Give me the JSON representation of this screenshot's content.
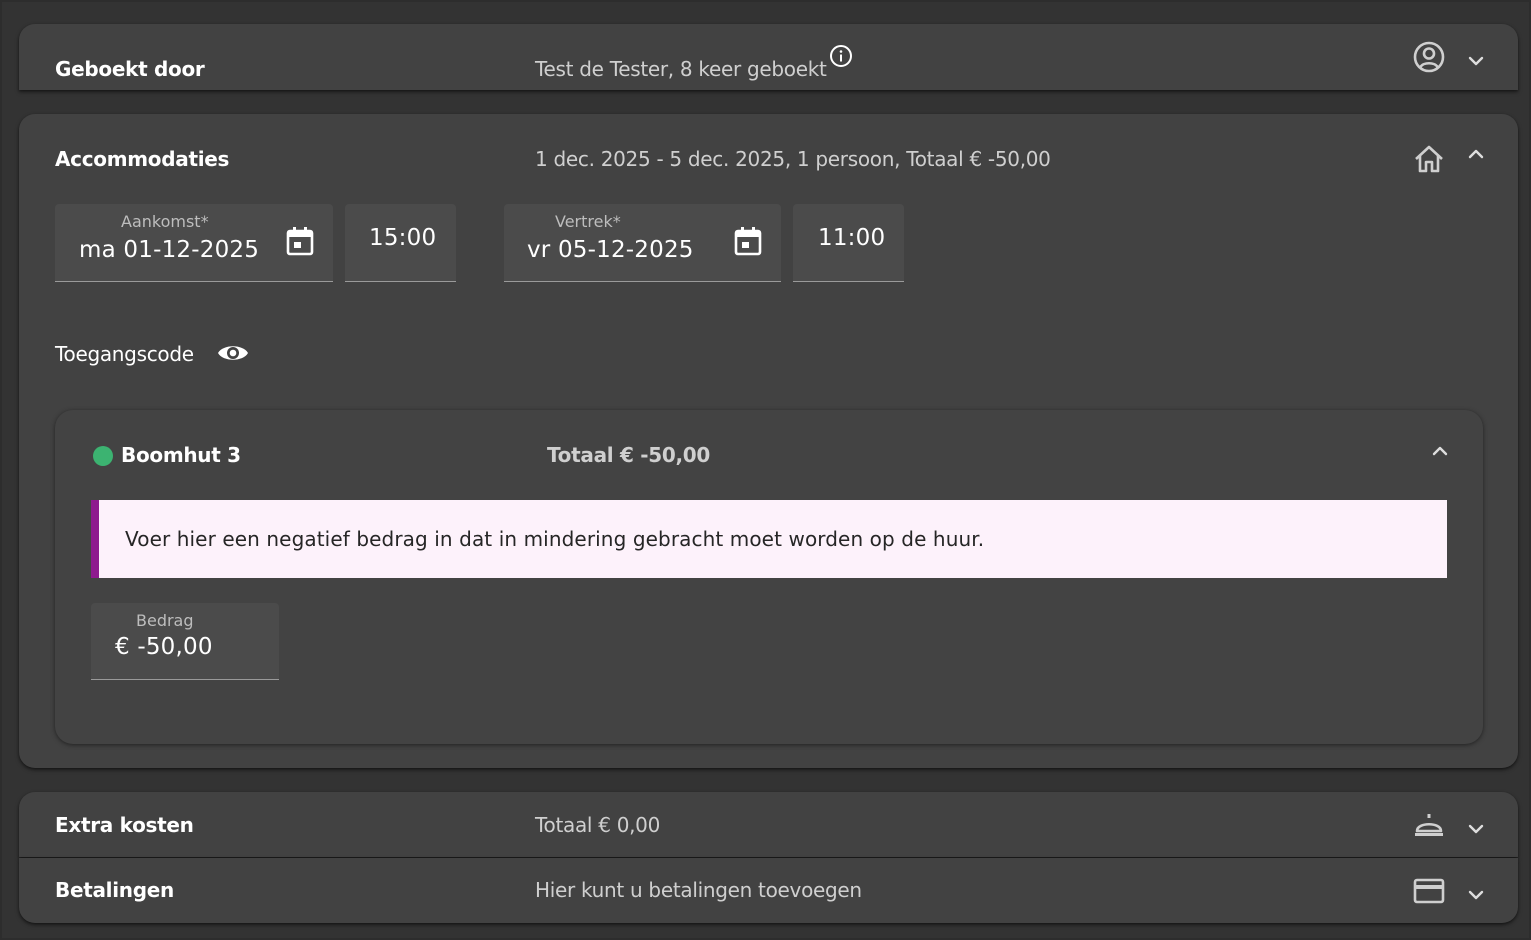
{
  "booked_by": {
    "title": "Geboekt door",
    "summary": "Test de Tester, 8 keer geboekt",
    "info_icon": "info-icon",
    "icon": "account-circle-icon",
    "chevron": "chevron-down-icon"
  },
  "accommodations": {
    "title": "Accommodaties",
    "summary": "1 dec. 2025 - 5 dec. 2025, 1 persoon, Totaal € -50,00",
    "icon": "home-icon",
    "chevron": "chevron-up-icon",
    "arrival": {
      "label": "Aankomst*",
      "value": "ma 01-12-2025",
      "time": "15:00"
    },
    "departure": {
      "label": "Vertrek*",
      "value": "vr 05-12-2025",
      "time": "11:00"
    },
    "access_code_label": "Toegangscode",
    "unit": {
      "name": "Boomhut 3",
      "status_color": "#3cb371",
      "total": "Totaal € -50,00",
      "notice": "Voer hier een negatief bedrag in dat in mindering gebracht moet worden op de huur.",
      "amount_label": "Bedrag",
      "amount_value": "€ -50,00"
    }
  },
  "extra_costs": {
    "title": "Extra kosten",
    "summary": "Totaal € 0,00",
    "icon": "room-service-icon"
  },
  "payments": {
    "title": "Betalingen",
    "summary": "Hier kunt u betalingen toevoegen",
    "icon": "credit-card-icon"
  },
  "colors": {
    "page_background": "#2d2d2d",
    "panel_background": "#424242",
    "field_background": "#4b4b4b",
    "accent_purple": "#8e1a8e",
    "notice_background": "#fdf2fb",
    "status_green": "#3cb371"
  }
}
